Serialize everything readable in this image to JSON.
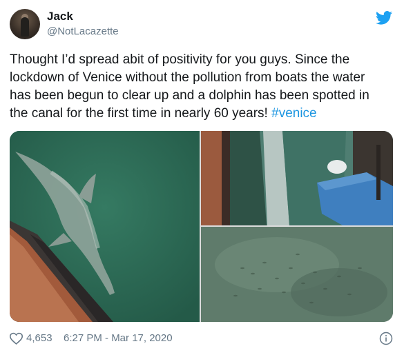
{
  "user": {
    "display_name": "Jack",
    "handle": "@NotLacazette"
  },
  "tweet": {
    "text": "Thought I’d spread abit of positivity for you guys. Since the\nlockdown of Venice without the pollution from boats the water\nhas been begun to clear up and a dolphin has been spotted in\nthe canal for the first time in nearly 60 years! ",
    "hashtag": "#venice"
  },
  "media": {
    "count": 3
  },
  "footer": {
    "like_count": "4,653",
    "timestamp": "6:27 PM - Mar 17, 2020"
  },
  "icons": {
    "brand": "twitter-bird-icon",
    "like": "heart-icon",
    "info": "info-icon"
  },
  "colors": {
    "accent": "#1da1f2",
    "hashtag": "#1b95e0",
    "secondary_text": "#657786",
    "primary_text": "#14171a"
  }
}
